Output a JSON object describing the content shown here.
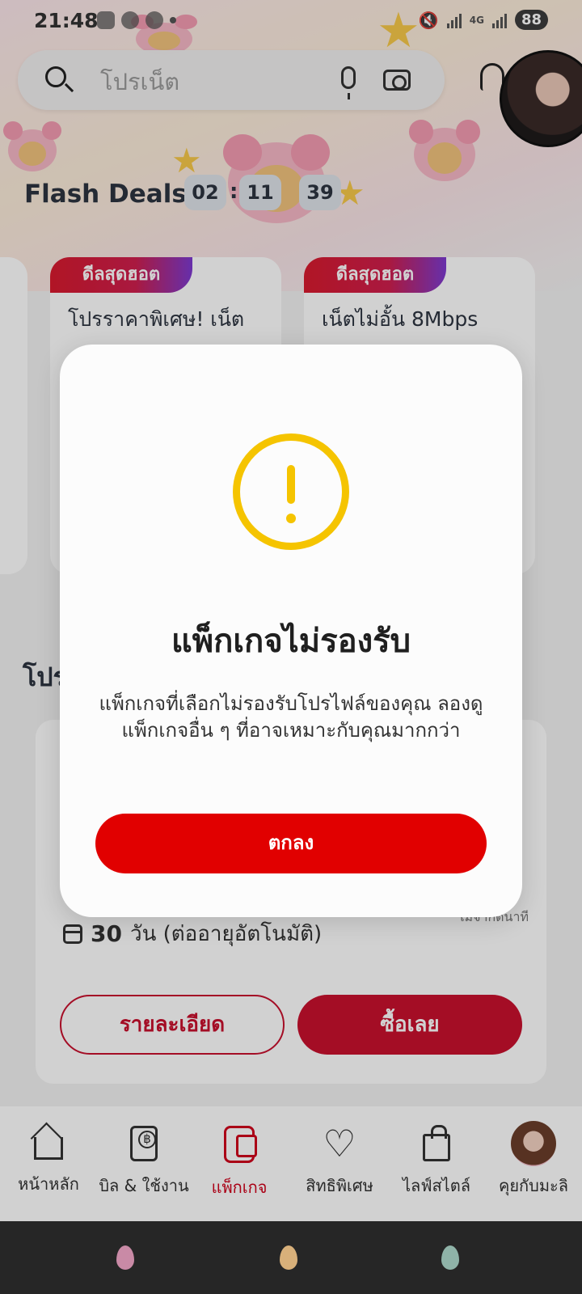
{
  "status_bar": {
    "time": "21:48",
    "network": "4G",
    "battery": "88"
  },
  "search": {
    "placeholder": "โปรเน็ต"
  },
  "flash_deals": {
    "title": "Flash Deals",
    "timer": [
      "02",
      "11",
      "39"
    ],
    "cards": [
      {
        "badge": "ดีลสุดฮอต",
        "text": "โปรราคาพิเศษ! เน็ต"
      },
      {
        "badge": "ดีลสุดฮอต",
        "text": "เน็ตไม่อั้น 8Mbps"
      }
    ]
  },
  "section": {
    "title": "โปร"
  },
  "package": {
    "duration_number": "30",
    "duration_text": "วัน (ต่ออายุอัตโนมัติ)",
    "side_note": "ไม่จำกัดนาที",
    "details_label": "รายละเอียด",
    "buy_label": "ซื้อเลย"
  },
  "bottom_nav": [
    {
      "label": "หน้าหลัก",
      "icon": "home-icon"
    },
    {
      "label": "บิล & ใช้งาน",
      "icon": "bill-icon"
    },
    {
      "label": "แพ็กเกจ",
      "icon": "package-icon",
      "active": true
    },
    {
      "label": "สิทธิพิเศษ",
      "icon": "heart-icon"
    },
    {
      "label": "ไลฟ์สไตล์",
      "icon": "shopping-bag-icon"
    },
    {
      "label": "คุยกับมะลิ",
      "icon": "chat-avatar-icon"
    }
  ],
  "dialog": {
    "title": "แพ็กเกจไม่รองรับ",
    "message": "แพ็กเกจที่เลือกไม่รองรับโปรไฟล์ของคุณ ลองดูแพ็กเกจอื่น ๆ ที่อาจเหมาะกับคุณมากกว่า",
    "confirm_label": "ตกลง",
    "icon": "warning-icon"
  },
  "colors": {
    "brand_red": "#e10000",
    "warning_yellow": "#f5c400"
  }
}
